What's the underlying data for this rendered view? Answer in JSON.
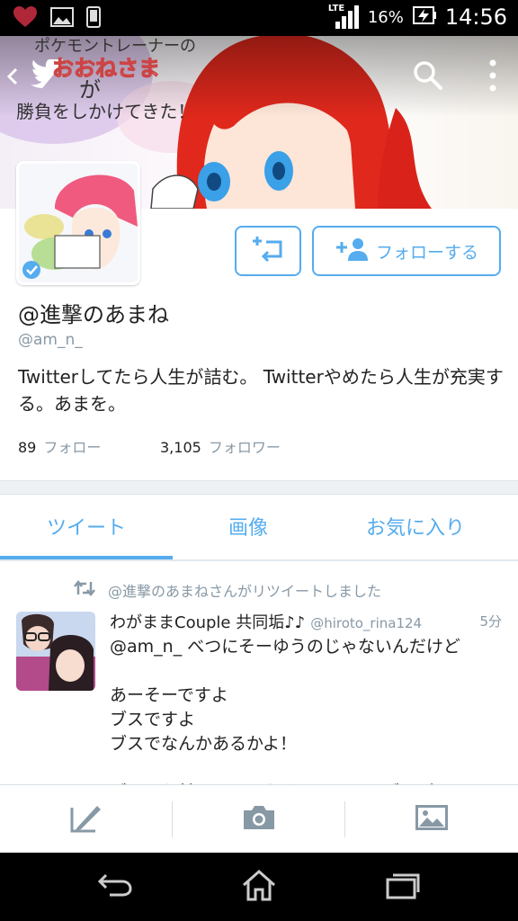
{
  "status_bar": {
    "icons": [
      "heart-icon",
      "image-icon",
      "phone-icon",
      "lte-signal-icon",
      "battery-icon"
    ],
    "network": "LTE",
    "battery": "16%",
    "time": "14:56"
  },
  "header": {
    "icons": [
      "back-icon",
      "twitter-bird-icon",
      "search-icon",
      "overflow-menu-icon"
    ],
    "banner_text": [
      "ポケモントレーナーの",
      "おおねさま",
      "が",
      "勝負をしかけてきた！"
    ]
  },
  "actions": {
    "retweet_btn_icon": "retweet-add-icon",
    "follow_label": "フォローする",
    "follow_icon": "add-person-icon"
  },
  "profile": {
    "name": "@進撃のあまね",
    "handle": "@am_n_",
    "bio": "Twitterしてたら人生が詰む。 Twitterやめたら人生が充実する。あまを。",
    "following_count": "89",
    "following_label": "フォロー",
    "followers_count": "3,105",
    "followers_label": "フォロワー"
  },
  "tabs": [
    {
      "label": "ツイート",
      "active": true
    },
    {
      "label": "画像",
      "active": false
    },
    {
      "label": "お気に入り",
      "active": false
    }
  ],
  "tweet": {
    "retweet_note": "@進撃のあまねさんがリツイートしました",
    "author": "わがままCouple 共同垢♪♪",
    "username": "@hiroto_rina124",
    "time": "5分",
    "text": "@am_n_ べつにそーゆうのじゃないんだけど\n\nあーそーですよ\nブスですよ\nブスでなんかあるかよ！\n\nブーリお前らみたいなやつのせいでブスが"
  },
  "composer": {
    "icons": [
      "compose-icon",
      "camera-icon",
      "gallery-icon"
    ]
  },
  "nav": {
    "icons": [
      "nav-back-icon",
      "nav-home-icon",
      "nav-recents-icon"
    ]
  },
  "colors": {
    "accent": "#55acee",
    "muted": "#8899a6",
    "text": "#222222"
  }
}
